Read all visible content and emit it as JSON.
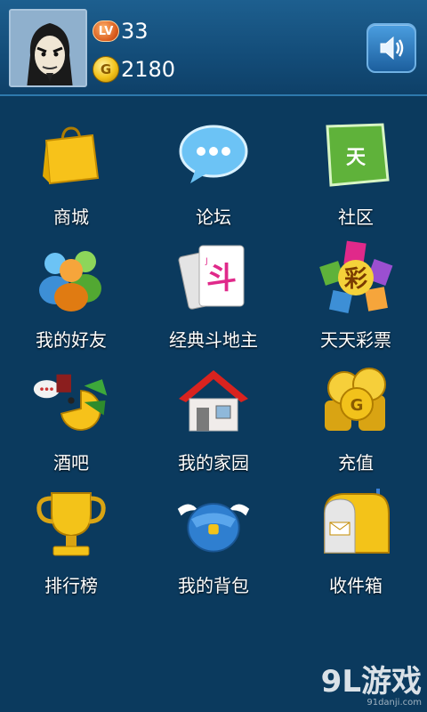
{
  "user": {
    "level_badge": "LV",
    "level": "33",
    "coins": "2180"
  },
  "header": {
    "sound_icon": "speaker-icon"
  },
  "menu": [
    {
      "label": "商城",
      "icon": "shopping-bag-icon"
    },
    {
      "label": "论坛",
      "icon": "chat-bubble-icon"
    },
    {
      "label": "社区",
      "icon": "community-icon"
    },
    {
      "label": "我的好友",
      "icon": "friends-icon"
    },
    {
      "label": "经典斗地主",
      "icon": "playing-cards-icon"
    },
    {
      "label": "天天彩票",
      "icon": "lottery-icon"
    },
    {
      "label": "酒吧",
      "icon": "bar-icon"
    },
    {
      "label": "我的家园",
      "icon": "house-icon"
    },
    {
      "label": "充值",
      "icon": "coin-stack-icon"
    },
    {
      "label": "排行榜",
      "icon": "trophy-icon"
    },
    {
      "label": "我的背包",
      "icon": "backpack-icon"
    },
    {
      "label": "收件箱",
      "icon": "mailbox-icon"
    }
  ],
  "watermark": {
    "main": "9L游戏",
    "sub": "91danji.com"
  }
}
